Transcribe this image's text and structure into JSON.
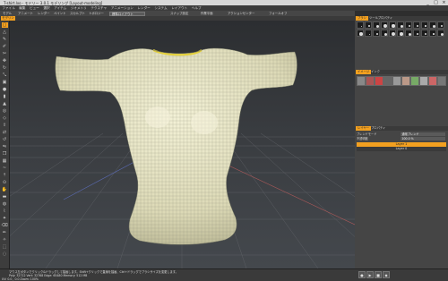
{
  "app": {
    "title": "T-shirt.lxo - モドリー 3.0.1 モデリング [Layout-modeling]",
    "window_controls": [
      "_",
      "□",
      "×"
    ]
  },
  "menu": {
    "items": [
      "ファイル",
      "編集",
      "ビュー",
      "選択",
      "アイテム",
      "ジオメトリ",
      "テクスチャ",
      "アニメーション",
      "レンダー",
      "システム",
      "レイアウト",
      "ヘルプ"
    ]
  },
  "toolbar": {
    "left_buttons": [
      "モデル",
      "アニメート",
      "レンダー",
      "ペイント",
      "スカルプト",
      "トポロジー"
    ],
    "layout_dropdown": "標準ロイアウト",
    "right_buttons": [
      "スナップ設定",
      "作業平面",
      "アクションセンター",
      "フォールオフ"
    ]
  },
  "tabs": {
    "active": "モデリング"
  },
  "left_tools": {
    "icons": [
      "square",
      "triangle",
      "pen",
      "brush",
      "knife",
      "move",
      "rotate",
      "scale",
      "cube",
      "sphere",
      "cylinder",
      "cone",
      "torus",
      "bevel",
      "extrude",
      "bridge",
      "loop",
      "mirror",
      "clone",
      "array",
      "smooth",
      "push",
      "magnet",
      "drag",
      "flatten",
      "inflate",
      "carve",
      "tweak",
      "erase",
      "paint",
      "pick",
      "select",
      "lasso"
    ]
  },
  "viewport": {
    "colors": {
      "wire": "#8c8f7a",
      "mesh_fill": "#efedcf",
      "collar": "#e3cf3a",
      "grid": "#66696e",
      "axis_x": "#b05a5a",
      "axis_z": "#5a6ab0"
    }
  },
  "right_panel": {
    "top_tabs": [
      "ブラシ",
      "ツールプロパティ"
    ],
    "brush_grid_label": "",
    "image_tabs": [
      "イメージ",
      "インク"
    ],
    "lower_tabs": [
      "レイヤー",
      "プロパティ"
    ],
    "properties": [
      {
        "label": "ブレンドモード",
        "value": "通常ブレンド"
      },
      {
        "label": "不透明度",
        "value": "100.0 %"
      }
    ],
    "layers": [
      {
        "name": "Layer 1",
        "selected": true
      },
      {
        "name": "Layer 0",
        "selected": false
      }
    ]
  },
  "status": {
    "line1": "マウス左ボタンでクリック&ドラッグして描画します。Shift+クリックで直線を描画、Ctrl+ドラッグでブラシサイズを変更します。",
    "line2": "Poly: 32712  Vert: 32768  Edge: 65480  Memory: 512 MB",
    "line3": "UV: 0.0 , 0.0  Zoom: 100%"
  }
}
